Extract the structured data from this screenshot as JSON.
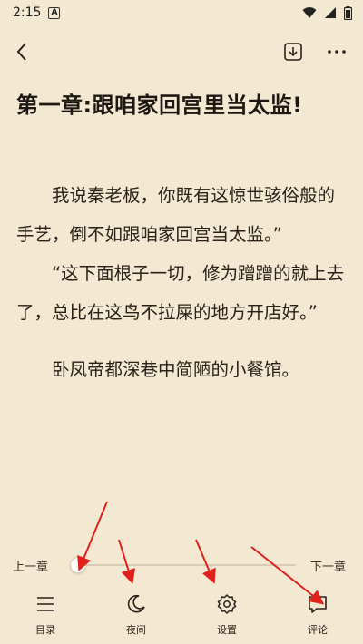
{
  "status_bar": {
    "time": "2:15",
    "notification": "A"
  },
  "top_nav": {
    "back_icon": "chevron-left-icon",
    "download_icon": "download-icon",
    "more_icon": "more-horizontal-icon"
  },
  "chapter": {
    "title": "第一章:跟咱家回宫里当太监!",
    "paragraphs": [
      "我说秦老板，你既有这惊世骇俗般的手艺，倒不如跟咱家回宫当太监。”",
      "“这下面根子一切，修为蹭蹭的就上去了，总比在这鸟不拉屎的地方开店好。”",
      "卧凤帝都深巷中简陋的小餐馆。"
    ]
  },
  "progress": {
    "prev_label": "上一章",
    "next_label": "下一章",
    "value": 0.0
  },
  "toolbar": {
    "items": [
      {
        "label": "目录",
        "icon": "catalog-list-icon"
      },
      {
        "label": "夜间",
        "icon": "moon-icon"
      },
      {
        "label": "设置",
        "icon": "gear-icon"
      },
      {
        "label": "评论",
        "icon": "comment-icon"
      }
    ]
  },
  "colors": {
    "background": "#f3e8d2",
    "annotation_arrow": "#e0201a",
    "text": "#2a2118"
  }
}
